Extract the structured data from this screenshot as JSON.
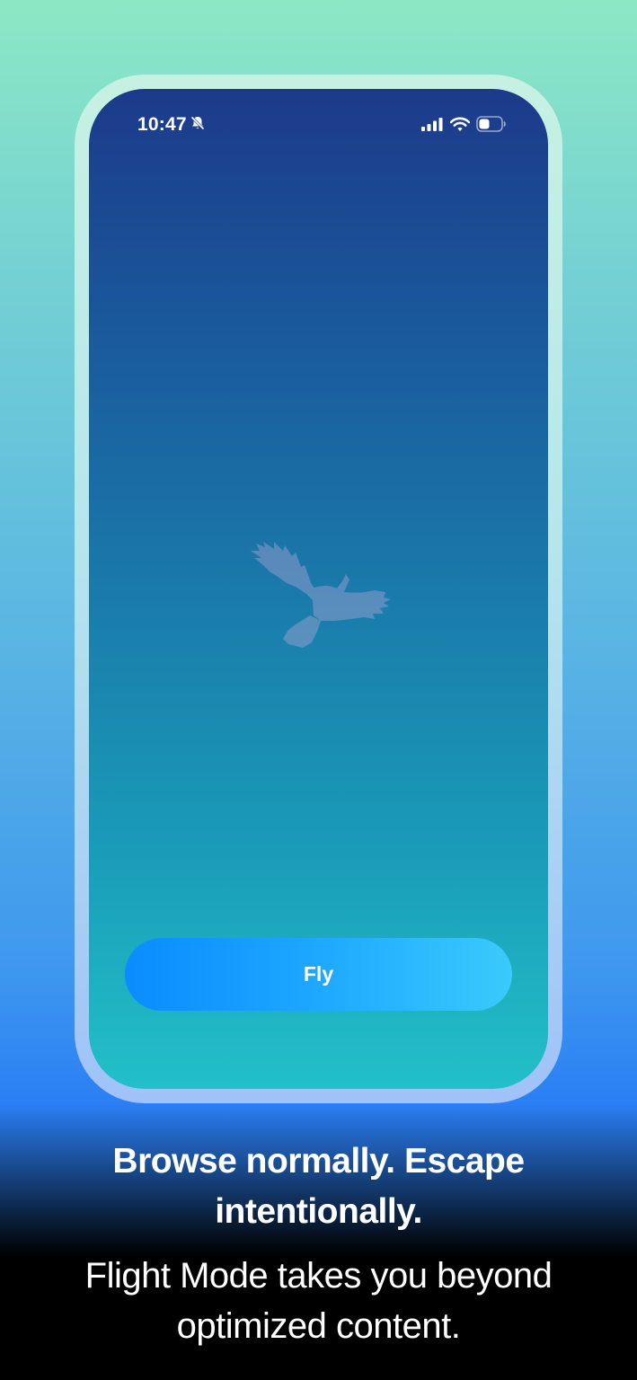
{
  "status_bar": {
    "time": "10:47",
    "icons": [
      "bell-slash-icon",
      "cellular-signal-icon",
      "wifi-icon",
      "battery-icon"
    ]
  },
  "main": {
    "illustration": "bird-silhouette-icon",
    "fly_button_label": "Fly"
  },
  "caption": {
    "headline": "Browse normally. Escape intentionally.",
    "subtitle": "Flight Mode takes you beyond optimized content."
  },
  "colors": {
    "background_top": "#8ce8c4",
    "background_bottom": "#2b7ff4",
    "screen_top": "#1c3a8a",
    "screen_bottom": "#22c0c8",
    "button_start": "#0a8cff",
    "button_end": "#3bcafc",
    "text": "#ffffff"
  }
}
